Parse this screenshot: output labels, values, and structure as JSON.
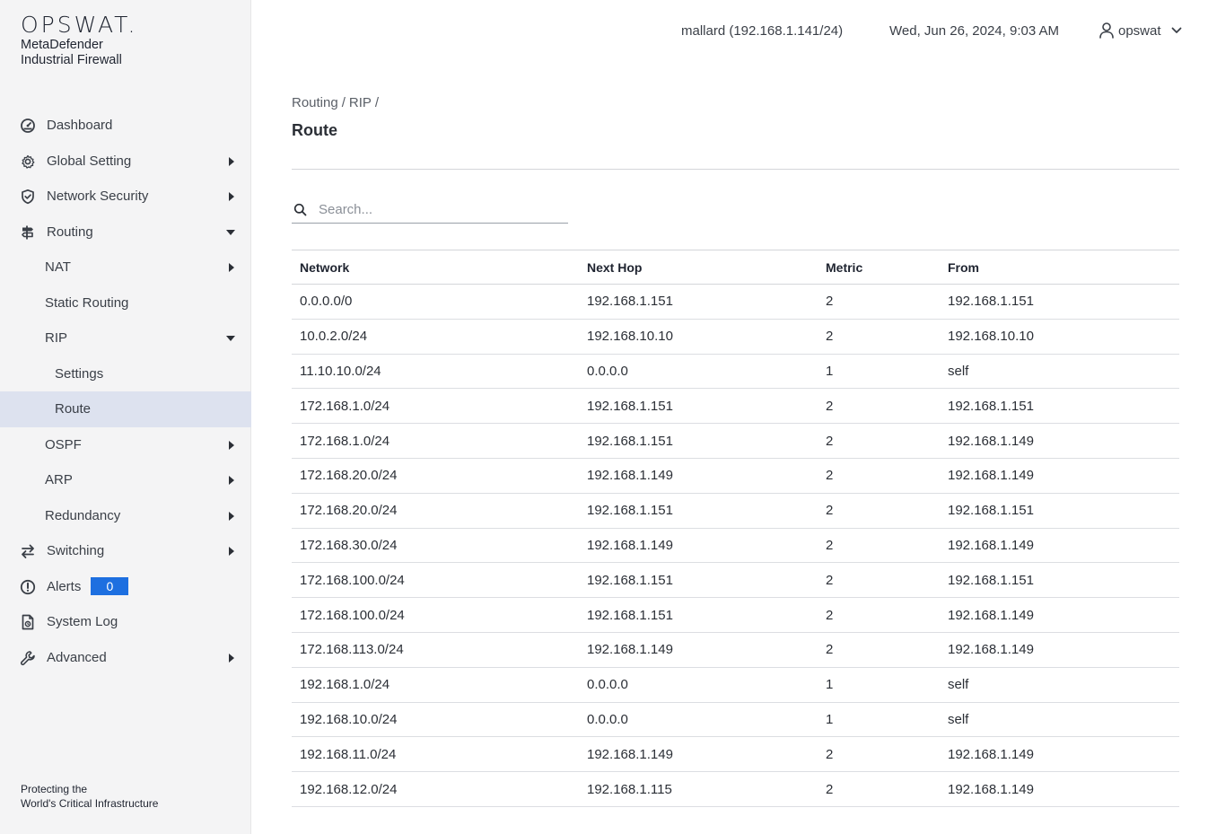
{
  "brand": {
    "logo": "OPSWAT.",
    "product_line1": "MetaDefender",
    "product_line2": "Industrial Firewall",
    "tagline_line1": "Protecting the",
    "tagline_line2": "World's Critical Infrastructure"
  },
  "header": {
    "host": "mallard (192.168.1.141/24)",
    "datetime": "Wed, Jun 26, 2024, 9:03 AM",
    "username": "opswat"
  },
  "sidebar": {
    "items": [
      {
        "label": "Dashboard",
        "icon": "dashboard-icon"
      },
      {
        "label": "Global Setting",
        "icon": "gear-icon",
        "expandable": true
      },
      {
        "label": "Network Security",
        "icon": "shield-icon",
        "expandable": true
      },
      {
        "label": "Routing",
        "icon": "signpost-icon",
        "expanded": true
      },
      {
        "label": "NAT",
        "expandable": true
      },
      {
        "label": "Static Routing"
      },
      {
        "label": "RIP",
        "expanded": true
      },
      {
        "label": "Settings"
      },
      {
        "label": "Route",
        "active": true
      },
      {
        "label": "OSPF",
        "expandable": true
      },
      {
        "label": "ARP",
        "expandable": true
      },
      {
        "label": "Redundancy",
        "expandable": true
      },
      {
        "label": "Switching",
        "icon": "swap-arrows-icon",
        "expandable": true
      },
      {
        "label": "Alerts",
        "icon": "alert-circle-icon",
        "badge": "0"
      },
      {
        "label": "System Log",
        "icon": "document-icon"
      },
      {
        "label": "Advanced",
        "icon": "wrench-icon",
        "expandable": true
      }
    ]
  },
  "breadcrumb": [
    "Routing",
    "/",
    "RIP",
    "/"
  ],
  "page_title": "Route",
  "search": {
    "placeholder": "Search...",
    "value": ""
  },
  "table": {
    "columns": [
      "Network",
      "Next Hop",
      "Metric",
      "From"
    ],
    "rows": [
      [
        "0.0.0.0/0",
        "192.168.1.151",
        "2",
        "192.168.1.151"
      ],
      [
        "10.0.2.0/24",
        "192.168.10.10",
        "2",
        "192.168.10.10"
      ],
      [
        "11.10.10.0/24",
        "0.0.0.0",
        "1",
        "self"
      ],
      [
        "172.168.1.0/24",
        "192.168.1.151",
        "2",
        "192.168.1.151"
      ],
      [
        "172.168.1.0/24",
        "192.168.1.151",
        "2",
        "192.168.1.149"
      ],
      [
        "172.168.20.0/24",
        "192.168.1.149",
        "2",
        "192.168.1.149"
      ],
      [
        "172.168.20.0/24",
        "192.168.1.151",
        "2",
        "192.168.1.151"
      ],
      [
        "172.168.30.0/24",
        "192.168.1.149",
        "2",
        "192.168.1.149"
      ],
      [
        "172.168.100.0/24",
        "192.168.1.151",
        "2",
        "192.168.1.151"
      ],
      [
        "172.168.100.0/24",
        "192.168.1.151",
        "2",
        "192.168.1.149"
      ],
      [
        "172.168.113.0/24",
        "192.168.1.149",
        "2",
        "192.168.1.149"
      ],
      [
        "192.168.1.0/24",
        "0.0.0.0",
        "1",
        "self"
      ],
      [
        "192.168.10.0/24",
        "0.0.0.0",
        "1",
        "self"
      ],
      [
        "192.168.11.0/24",
        "192.168.1.149",
        "2",
        "192.168.1.149"
      ],
      [
        "192.168.12.0/24",
        "192.168.1.115",
        "2",
        "192.168.1.149"
      ]
    ]
  },
  "colors": {
    "accent": "#1d6fe0",
    "active_nav": "#dde2ef",
    "sidebar_bg": "#f4f4f5"
  }
}
